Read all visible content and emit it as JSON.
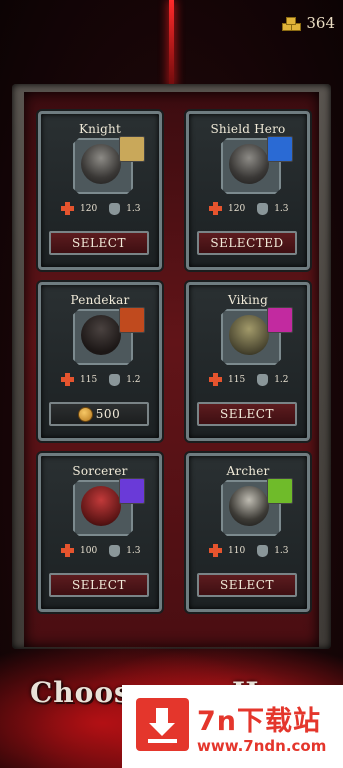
{
  "currency": {
    "amount": "364",
    "icon": "gold-bars-icon"
  },
  "heroes": [
    {
      "name": "Knight",
      "health": "120",
      "armor": "1.3",
      "button": "SELECT",
      "weapon": "sword-icon",
      "weapon_color": "#c9a85a"
    },
    {
      "name": "Shield Hero",
      "health": "120",
      "armor": "1.3",
      "button": "SELECTED",
      "weapon": "shield-icon",
      "weapon_color": "#2a6ad4"
    },
    {
      "name": "Pendekar",
      "health": "115",
      "armor": "1.2",
      "price": "500",
      "weapon": "blade-icon",
      "weapon_color": "#c04a1e"
    },
    {
      "name": "Viking",
      "health": "115",
      "armor": "1.2",
      "button": "SELECT",
      "weapon": "axe-icon",
      "weapon_color": "#c22aa0"
    },
    {
      "name": "Sorcerer",
      "health": "100",
      "armor": "1.3",
      "button": "SELECT",
      "weapon": "staff-icon",
      "weapon_color": "#6a3ad8"
    },
    {
      "name": "Archer",
      "health": "110",
      "armor": "1.3",
      "button": "SELECT",
      "weapon": "bow-icon",
      "weapon_color": "#6fbb2a"
    }
  ],
  "heading": {
    "left": "Choos",
    "right": "H"
  },
  "ad": {
    "title": "7n下载站",
    "url": "www.7ndn.com"
  }
}
